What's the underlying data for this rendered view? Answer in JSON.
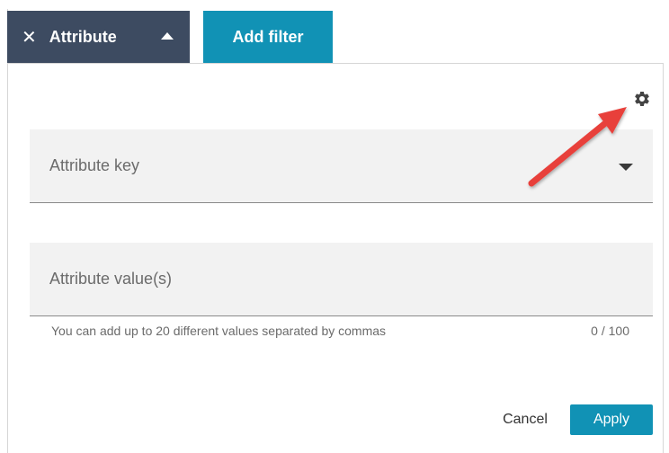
{
  "filter_bar": {
    "attribute_chip": {
      "close_glyph": "✕",
      "label": "Attribute",
      "caret_icon": "caret-up-icon"
    },
    "add_filter_label": "Add filter"
  },
  "panel": {
    "settings_icon": "gear-icon",
    "attribute_key": {
      "placeholder": "Attribute key",
      "caret_icon": "caret-down-icon"
    },
    "attribute_value": {
      "placeholder": "Attribute value(s)",
      "hint": "You can add up to 20 different values separated by commas",
      "counter": "0 / 100"
    },
    "cancel_label": "Cancel",
    "apply_label": "Apply"
  },
  "annotation": {
    "arrow_icon": "red-arrow-icon",
    "color": "#e8403b"
  },
  "colors": {
    "chip_dark": "#3d4b61",
    "accent": "#1192b5",
    "field_bg": "#f2f2f2"
  }
}
